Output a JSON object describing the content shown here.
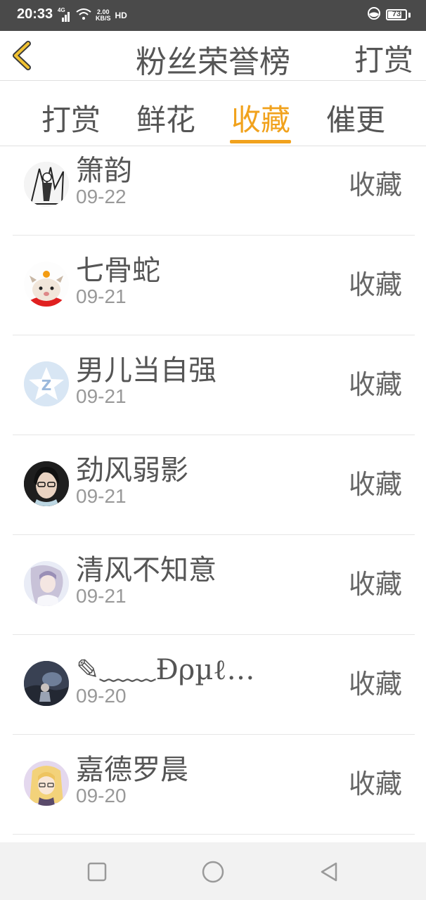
{
  "status_bar": {
    "time": "20:33",
    "network": "4G",
    "speed_value": "2.00",
    "speed_unit": "KB/S",
    "hd": "HD",
    "battery": "73"
  },
  "header": {
    "title": "粉丝荣誉榜",
    "action_label": "打赏"
  },
  "tabs": [
    {
      "label": "打赏",
      "active": false
    },
    {
      "label": "鲜花",
      "active": false
    },
    {
      "label": "收藏",
      "active": true
    },
    {
      "label": "催更",
      "active": false
    }
  ],
  "accent_color": "#f1a21d",
  "list": {
    "items": [
      {
        "name": "箫韵",
        "date": "09-22",
        "action": "收藏"
      },
      {
        "name": "七骨蛇",
        "date": "09-21",
        "action": "收藏"
      },
      {
        "name": "男儿当自强",
        "date": "09-21",
        "action": "收藏"
      },
      {
        "name": "劲风弱影",
        "date": "09-21",
        "action": "收藏"
      },
      {
        "name": "清风不知意",
        "date": "09-21",
        "action": "收藏"
      },
      {
        "name": "✎﹏﹏Ɖρµℓ…",
        "date": "09-20",
        "action": "收藏"
      },
      {
        "name": "嘉德罗晨",
        "date": "09-20",
        "action": "收藏"
      }
    ]
  }
}
